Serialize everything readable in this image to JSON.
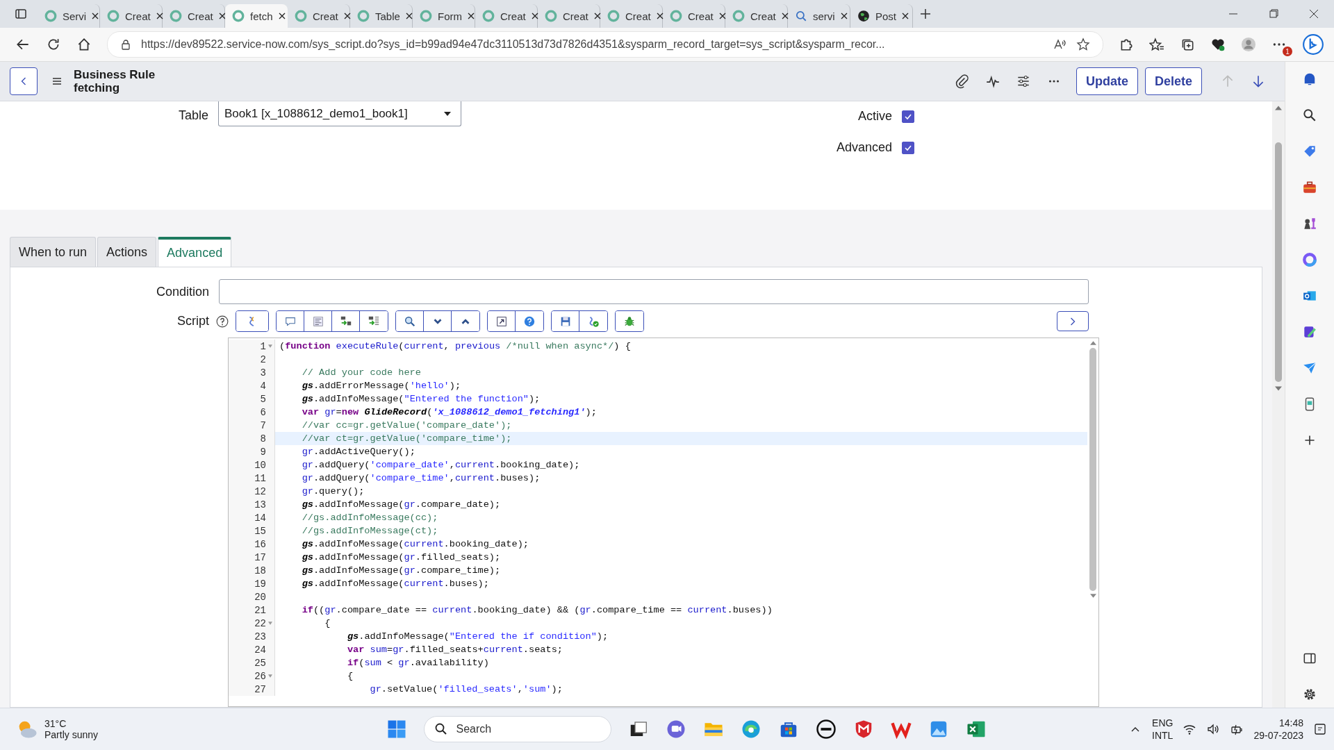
{
  "browser_tabs": [
    {
      "title": "Servi",
      "kind": "site",
      "selected": false
    },
    {
      "title": "Creat",
      "kind": "site",
      "selected": false
    },
    {
      "title": "Creat",
      "kind": "site",
      "selected": false
    },
    {
      "title": "fetch",
      "kind": "site",
      "selected": true
    },
    {
      "title": "Creat",
      "kind": "site",
      "selected": false
    },
    {
      "title": "Table",
      "kind": "site",
      "selected": false
    },
    {
      "title": "Form",
      "kind": "site",
      "selected": false
    },
    {
      "title": "Creat",
      "kind": "site",
      "selected": false
    },
    {
      "title": "Creat",
      "kind": "site",
      "selected": false
    },
    {
      "title": "Creat",
      "kind": "site",
      "selected": false
    },
    {
      "title": "Creat",
      "kind": "site",
      "selected": false
    },
    {
      "title": "Creat",
      "kind": "site",
      "selected": false
    },
    {
      "title": "servi",
      "kind": "search",
      "selected": false
    },
    {
      "title": "Post",
      "kind": "globe",
      "selected": false
    }
  ],
  "address_bar": {
    "url": "https://dev89522.service-now.com/sys_script.do?sys_id=b99ad94e47dc3110513d73d7826d4351&sysparm_record_target=sys_script&sysparm_recor..."
  },
  "menu_badge": "1",
  "header": {
    "title": "Business Rule",
    "subtitle": "fetching",
    "buttons": [
      "Update",
      "Delete"
    ]
  },
  "form": {
    "table": {
      "label": "Table",
      "value": "Book1 [x_1088612_demo1_book1]"
    },
    "checkboxes": [
      {
        "label": "Active",
        "checked": true
      },
      {
        "label": "Advanced",
        "checked": true
      }
    ]
  },
  "section_tabs": [
    {
      "label": "When to run",
      "selected": false
    },
    {
      "label": "Actions",
      "selected": false
    },
    {
      "label": "Advanced",
      "selected": true
    }
  ],
  "condition": {
    "label": "Condition"
  },
  "script": {
    "label": "Script",
    "lines": [
      {
        "number": "1",
        "fold": true,
        "highlighted": false,
        "tokens": [
          {
            "kind": "plain",
            "text": "("
          },
          {
            "kind": "keyword",
            "text": "function "
          },
          {
            "kind": "variable",
            "text": "executeRule"
          },
          {
            "kind": "plain",
            "text": "("
          },
          {
            "kind": "variable",
            "text": "current"
          },
          {
            "kind": "plain",
            "text": ", "
          },
          {
            "kind": "variable",
            "text": "previous "
          },
          {
            "kind": "comment",
            "text": "/*null when async*/"
          },
          {
            "kind": "plain",
            "text": ") {"
          }
        ]
      },
      {
        "number": "2",
        "fold": false,
        "highlighted": false
      },
      {
        "number": "3",
        "fold": false,
        "highlighted": false,
        "tokens": [
          {
            "kind": "comment",
            "text": "    // Add your code here"
          }
        ]
      },
      {
        "number": "4",
        "fold": false,
        "highlighted": false,
        "tokens": [
          {
            "kind": "global",
            "text": "    gs"
          },
          {
            "kind": "plain",
            "text": ".addErrorMessage("
          },
          {
            "kind": "string",
            "text": "'hello'"
          },
          {
            "kind": "plain",
            "text": ");"
          }
        ]
      },
      {
        "number": "5",
        "fold": false,
        "highlighted": false,
        "tokens": [
          {
            "kind": "global",
            "text": "    gs"
          },
          {
            "kind": "plain",
            "text": ".addInfoMessage("
          },
          {
            "kind": "string",
            "text": "\"Entered the function\""
          },
          {
            "kind": "plain",
            "text": ");"
          }
        ]
      },
      {
        "number": "6",
        "fold": false,
        "highlighted": false,
        "tokens": [
          {
            "kind": "keyword",
            "text": "    var "
          },
          {
            "kind": "variable",
            "text": "gr"
          },
          {
            "kind": "plain",
            "text": "="
          },
          {
            "kind": "keyword",
            "text": "new "
          },
          {
            "kind": "global",
            "text": "GlideRecord"
          },
          {
            "kind": "plain",
            "text": "("
          },
          {
            "kind": "global-string",
            "text": "'x_1088612_demo1_fetching1'"
          },
          {
            "kind": "plain",
            "text": ");"
          }
        ]
      },
      {
        "number": "7",
        "fold": false,
        "highlighted": false,
        "tokens": [
          {
            "kind": "comment",
            "text": "    //var cc=gr.getValue('compare_date');"
          }
        ]
      },
      {
        "number": "8",
        "fold": false,
        "highlighted": true,
        "tokens": [
          {
            "kind": "comment",
            "text": "    //var ct=gr.getValue('compare_time');"
          }
        ]
      },
      {
        "number": "9",
        "fold": false,
        "highlighted": false,
        "tokens": [
          {
            "kind": "variable",
            "text": "    gr"
          },
          {
            "kind": "plain",
            "text": ".addActiveQuery();"
          }
        ]
      },
      {
        "number": "10",
        "fold": false,
        "highlighted": false,
        "tokens": [
          {
            "kind": "variable",
            "text": "    gr"
          },
          {
            "kind": "plain",
            "text": ".addQuery("
          },
          {
            "kind": "string",
            "text": "'compare_date'"
          },
          {
            "kind": "plain",
            "text": ","
          },
          {
            "kind": "variable",
            "text": "current"
          },
          {
            "kind": "plain",
            "text": ".booking_date);"
          }
        ]
      },
      {
        "number": "11",
        "fold": false,
        "highlighted": false,
        "tokens": [
          {
            "kind": "variable",
            "text": "    gr"
          },
          {
            "kind": "plain",
            "text": ".addQuery("
          },
          {
            "kind": "string",
            "text": "'compare_time'"
          },
          {
            "kind": "plain",
            "text": ","
          },
          {
            "kind": "variable",
            "text": "current"
          },
          {
            "kind": "plain",
            "text": ".buses);"
          }
        ]
      },
      {
        "number": "12",
        "fold": false,
        "highlighted": false,
        "tokens": [
          {
            "kind": "variable",
            "text": "    gr"
          },
          {
            "kind": "plain",
            "text": ".query();"
          }
        ]
      },
      {
        "number": "13",
        "fold": false,
        "highlighted": false,
        "tokens": [
          {
            "kind": "global",
            "text": "    gs"
          },
          {
            "kind": "plain",
            "text": ".addInfoMessage("
          },
          {
            "kind": "variable",
            "text": "gr"
          },
          {
            "kind": "plain",
            "text": ".compare_date);"
          }
        ]
      },
      {
        "number": "14",
        "fold": false,
        "highlighted": false,
        "tokens": [
          {
            "kind": "comment",
            "text": "    //gs.addInfoMessage(cc);"
          }
        ]
      },
      {
        "number": "15",
        "fold": false,
        "highlighted": false,
        "tokens": [
          {
            "kind": "comment",
            "text": "    //gs.addInfoMessage(ct);"
          }
        ]
      },
      {
        "number": "16",
        "fold": false,
        "highlighted": false,
        "tokens": [
          {
            "kind": "global",
            "text": "    gs"
          },
          {
            "kind": "plain",
            "text": ".addInfoMessage("
          },
          {
            "kind": "variable",
            "text": "current"
          },
          {
            "kind": "plain",
            "text": ".booking_date);"
          }
        ]
      },
      {
        "number": "17",
        "fold": false,
        "highlighted": false,
        "tokens": [
          {
            "kind": "global",
            "text": "    gs"
          },
          {
            "kind": "plain",
            "text": ".addInfoMessage("
          },
          {
            "kind": "variable",
            "text": "gr"
          },
          {
            "kind": "plain",
            "text": ".filled_seats);"
          }
        ]
      },
      {
        "number": "18",
        "fold": false,
        "highlighted": false,
        "tokens": [
          {
            "kind": "global",
            "text": "    gs"
          },
          {
            "kind": "plain",
            "text": ".addInfoMessage("
          },
          {
            "kind": "variable",
            "text": "gr"
          },
          {
            "kind": "plain",
            "text": ".compare_time);"
          }
        ]
      },
      {
        "number": "19",
        "fold": false,
        "highlighted": false,
        "tokens": [
          {
            "kind": "global",
            "text": "    gs"
          },
          {
            "kind": "plain",
            "text": ".addInfoMessage("
          },
          {
            "kind": "variable",
            "text": "current"
          },
          {
            "kind": "plain",
            "text": ".buses);"
          }
        ]
      },
      {
        "number": "20",
        "fold": false,
        "highlighted": false
      },
      {
        "number": "21",
        "fold": false,
        "highlighted": false,
        "tokens": [
          {
            "kind": "keyword",
            "text": "    if"
          },
          {
            "kind": "plain",
            "text": "(("
          },
          {
            "kind": "variable",
            "text": "gr"
          },
          {
            "kind": "plain",
            "text": ".compare_date == "
          },
          {
            "kind": "variable",
            "text": "current"
          },
          {
            "kind": "plain",
            "text": ".booking_date) && ("
          },
          {
            "kind": "variable",
            "text": "gr"
          },
          {
            "kind": "plain",
            "text": ".compare_time == "
          },
          {
            "kind": "variable",
            "text": "current"
          },
          {
            "kind": "plain",
            "text": ".buses))"
          }
        ]
      },
      {
        "number": "22",
        "fold": true,
        "highlighted": false,
        "tokens": [
          {
            "kind": "plain",
            "text": "        {"
          }
        ]
      },
      {
        "number": "23",
        "fold": false,
        "highlighted": false,
        "tokens": [
          {
            "kind": "global",
            "text": "            gs"
          },
          {
            "kind": "plain",
            "text": ".addInfoMessage("
          },
          {
            "kind": "string",
            "text": "\"Entered the if condition\""
          },
          {
            "kind": "plain",
            "text": ");"
          }
        ]
      },
      {
        "number": "24",
        "fold": false,
        "highlighted": false,
        "tokens": [
          {
            "kind": "keyword",
            "text": "            var "
          },
          {
            "kind": "variable",
            "text": "sum"
          },
          {
            "kind": "plain",
            "text": "="
          },
          {
            "kind": "variable",
            "text": "gr"
          },
          {
            "kind": "plain",
            "text": ".filled_seats+"
          },
          {
            "kind": "variable",
            "text": "current"
          },
          {
            "kind": "plain",
            "text": ".seats;"
          }
        ]
      },
      {
        "number": "25",
        "fold": false,
        "highlighted": false,
        "tokens": [
          {
            "kind": "keyword",
            "text": "            if"
          },
          {
            "kind": "plain",
            "text": "("
          },
          {
            "kind": "variable",
            "text": "sum"
          },
          {
            "kind": "plain",
            "text": " < "
          },
          {
            "kind": "variable",
            "text": "gr"
          },
          {
            "kind": "plain",
            "text": ".availability)"
          }
        ]
      },
      {
        "number": "26",
        "fold": true,
        "highlighted": false,
        "tokens": [
          {
            "kind": "plain",
            "text": "            {"
          }
        ]
      },
      {
        "number": "27",
        "fold": false,
        "highlighted": false,
        "tokens": [
          {
            "kind": "variable",
            "text": "                gr"
          },
          {
            "kind": "plain",
            "text": ".setValue("
          },
          {
            "kind": "string",
            "text": "'filled_seats'"
          },
          {
            "kind": "plain",
            "text": ","
          },
          {
            "kind": "string",
            "text": "'sum'"
          },
          {
            "kind": "plain",
            "text": ");"
          }
        ]
      }
    ]
  },
  "taskbar": {
    "weather": {
      "temperature": "31°C",
      "description": "Partly sunny"
    },
    "search": {
      "placeholder": "Search"
    },
    "language": [
      "ENG",
      "INTL"
    ],
    "time": "14:48",
    "date": "29-07-2023"
  }
}
